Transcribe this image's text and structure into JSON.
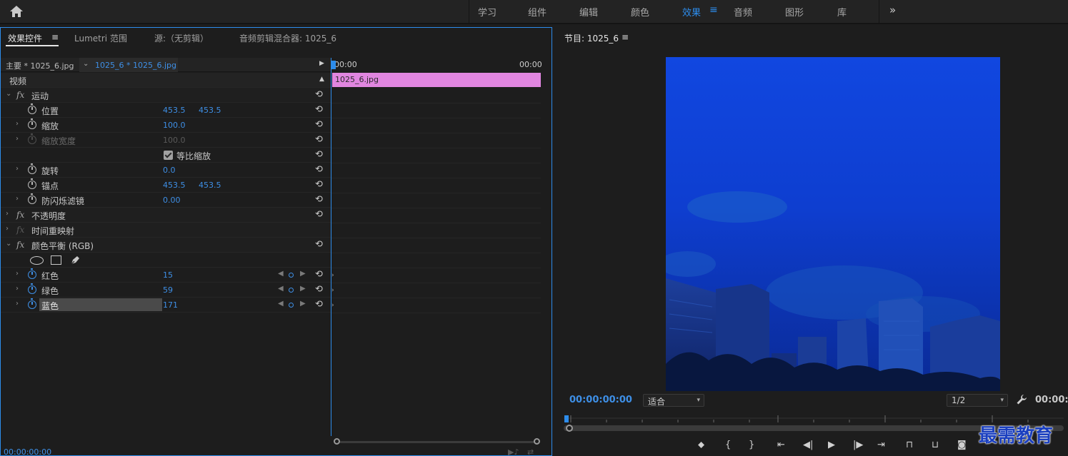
{
  "workspaces": {
    "items": [
      "学习",
      "组件",
      "编辑",
      "颜色",
      "效果",
      "音频",
      "图形",
      "库"
    ],
    "active": "效果",
    "menu_glyph": "≡",
    "more_glyph": "»"
  },
  "left_panel": {
    "tabs": [
      "效果控件",
      "Lumetri 范围",
      "源:（无剪辑）",
      "音频剪辑混合器: 1025_6"
    ],
    "tab_menu_glyph": "≡",
    "master_label": "主要 * 1025_6.jpg",
    "clip_selector": "1025_6 * 1025_6.jpg",
    "video_section": "视频",
    "timeline": {
      "start_tc": "00:00",
      "end_tc": "00:00",
      "clip_name": "1025_6.jpg"
    },
    "effects": {
      "motion": {
        "name": "运动",
        "position": {
          "label": "位置",
          "x": "453.5",
          "y": "453.5"
        },
        "scale": {
          "label": "缩放",
          "value": "100.0"
        },
        "scale_width": {
          "label": "缩放宽度",
          "value": "100.0"
        },
        "uniform_scale": {
          "label": "等比缩放",
          "checked": true
        },
        "rotation": {
          "label": "旋转",
          "value": "0.0"
        },
        "anchor": {
          "label": "锚点",
          "x": "453.5",
          "y": "453.5"
        },
        "anti_flicker": {
          "label": "防闪烁滤镜",
          "value": "0.00"
        }
      },
      "opacity": {
        "name": "不透明度"
      },
      "time_remap": {
        "name": "时间重映射"
      },
      "color_balance": {
        "name": "颜色平衡 (RGB)",
        "red": {
          "label": "红色",
          "value": "15"
        },
        "green": {
          "label": "绿色",
          "value": "59"
        },
        "blue": {
          "label": "蓝色",
          "value": "171"
        }
      }
    },
    "bottom_timecode": "00:00:00:00"
  },
  "program_monitor": {
    "title": "节目: 1025_6",
    "menu_glyph": "≡",
    "timecode": "00:00:00:00",
    "timecode_right": "00:00:",
    "fit_label": "适合",
    "resolution": "1/2",
    "transport": [
      "marker-button",
      "in-point-button",
      "out-point-button",
      "go-to-in-button",
      "step-back-button",
      "play-button",
      "step-forward-button",
      "go-to-out-button",
      "lift-button",
      "extract-button",
      "export-frame-button"
    ]
  },
  "watermark": "最需教育",
  "colors": {
    "accent": "#2d8ceb",
    "clip": "#e186e0",
    "value_blue": "#3e8fe6"
  }
}
